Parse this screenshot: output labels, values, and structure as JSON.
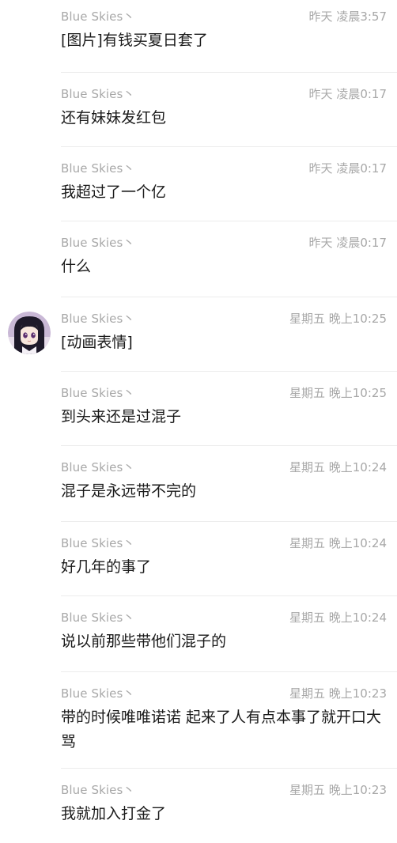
{
  "messages": [
    {
      "sender": "Blue Skies丶",
      "time": "昨天 凌晨3:57",
      "text": "[图片]有钱买夏日套了",
      "has_avatar": false
    },
    {
      "sender": "Blue Skies丶",
      "time": "昨天 凌晨0:17",
      "text": "还有妹妹发红包",
      "has_avatar": false
    },
    {
      "sender": "Blue Skies丶",
      "time": "昨天 凌晨0:17",
      "text": "我超过了一个亿",
      "has_avatar": false
    },
    {
      "sender": "Blue Skies丶",
      "time": "昨天 凌晨0:17",
      "text": "什么",
      "has_avatar": false
    },
    {
      "sender": "Blue Skies丶",
      "time": "星期五 晚上10:25",
      "text": "[动画表情]",
      "has_avatar": true
    },
    {
      "sender": "Blue Skies丶",
      "time": "星期五 晚上10:25",
      "text": "到头来还是过混子",
      "has_avatar": false
    },
    {
      "sender": "Blue Skies丶",
      "time": "星期五 晚上10:24",
      "text": "混子是永远带不完的",
      "has_avatar": false
    },
    {
      "sender": "Blue Skies丶",
      "time": "星期五 晚上10:24",
      "text": "好几年的事了",
      "has_avatar": false
    },
    {
      "sender": "Blue Skies丶",
      "time": "星期五 晚上10:24",
      "text": "说以前那些带他们混子的",
      "has_avatar": false
    },
    {
      "sender": "Blue Skies丶",
      "time": "星期五 晚上10:23",
      "text": "带的时候唯唯诺诺 起来了人有点本事了就开口大骂",
      "has_avatar": false
    },
    {
      "sender": "Blue Skies丶",
      "time": "星期五 晚上10:23",
      "text": "我就加入打金了",
      "has_avatar": false
    }
  ],
  "colors": {
    "meta_text": "#a8a8a8",
    "message_text": "#1a1a1a",
    "divider": "#ececec",
    "background": "#ffffff"
  }
}
